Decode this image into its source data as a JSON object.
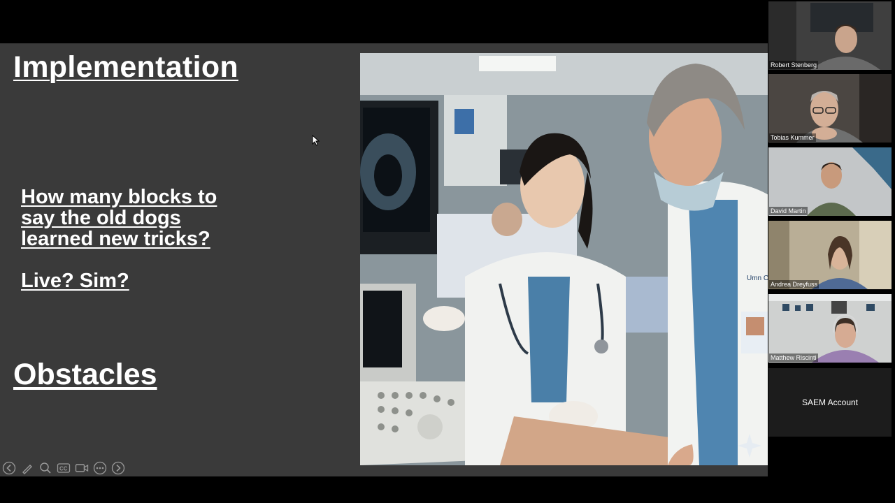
{
  "slide": {
    "title": "Implementation",
    "question_lines": [
      "How many blocks to",
      "say the old dogs",
      "learned new tricks?"
    ],
    "question2": "Live? Sim?",
    "obstacles": "Obstacles",
    "photo_badge_text": "Umn Ca"
  },
  "toolbar": {
    "icons": [
      "back-arrow-icon",
      "pen-icon",
      "zoom-icon",
      "captions-icon",
      "video-icon",
      "more-icon",
      "forward-arrow-icon"
    ],
    "captions_label": "CC"
  },
  "participants": [
    {
      "name": "Robert Stenberg"
    },
    {
      "name": "Tobias Kummer"
    },
    {
      "name": "David Martin"
    },
    {
      "name": "Andrea Dreyfuss"
    },
    {
      "name": "Matthew Riscinti"
    },
    {
      "name": "SAEM Account"
    }
  ],
  "colors": {
    "slide_bg": "#3a3a3a",
    "page_bg": "#000000",
    "text": "#ffffff",
    "scrub_blue": "#4a7fa8"
  }
}
